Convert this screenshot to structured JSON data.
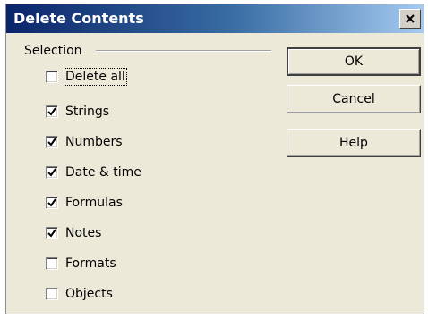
{
  "dialog": {
    "title": "Delete Contents",
    "close_glyph": "×"
  },
  "selection": {
    "label": "Selection",
    "items": [
      {
        "name": "delete-all",
        "label": "Delete all",
        "checked": false
      },
      {
        "name": "strings",
        "label": "Strings",
        "checked": true
      },
      {
        "name": "numbers",
        "label": "Numbers",
        "checked": true
      },
      {
        "name": "date-time",
        "label": "Date & time",
        "checked": true
      },
      {
        "name": "formulas",
        "label": "Formulas",
        "checked": true
      },
      {
        "name": "notes",
        "label": "Notes",
        "checked": true
      },
      {
        "name": "formats",
        "label": "Formats",
        "checked": false
      },
      {
        "name": "objects",
        "label": "Objects",
        "checked": false
      }
    ]
  },
  "buttons": {
    "ok": "OK",
    "cancel": "Cancel",
    "help": "Help"
  },
  "colors": {
    "title_gradient_start": "#0a246a",
    "title_gradient_end": "#a6caf0",
    "dialog_bg": "#ece9d8"
  }
}
